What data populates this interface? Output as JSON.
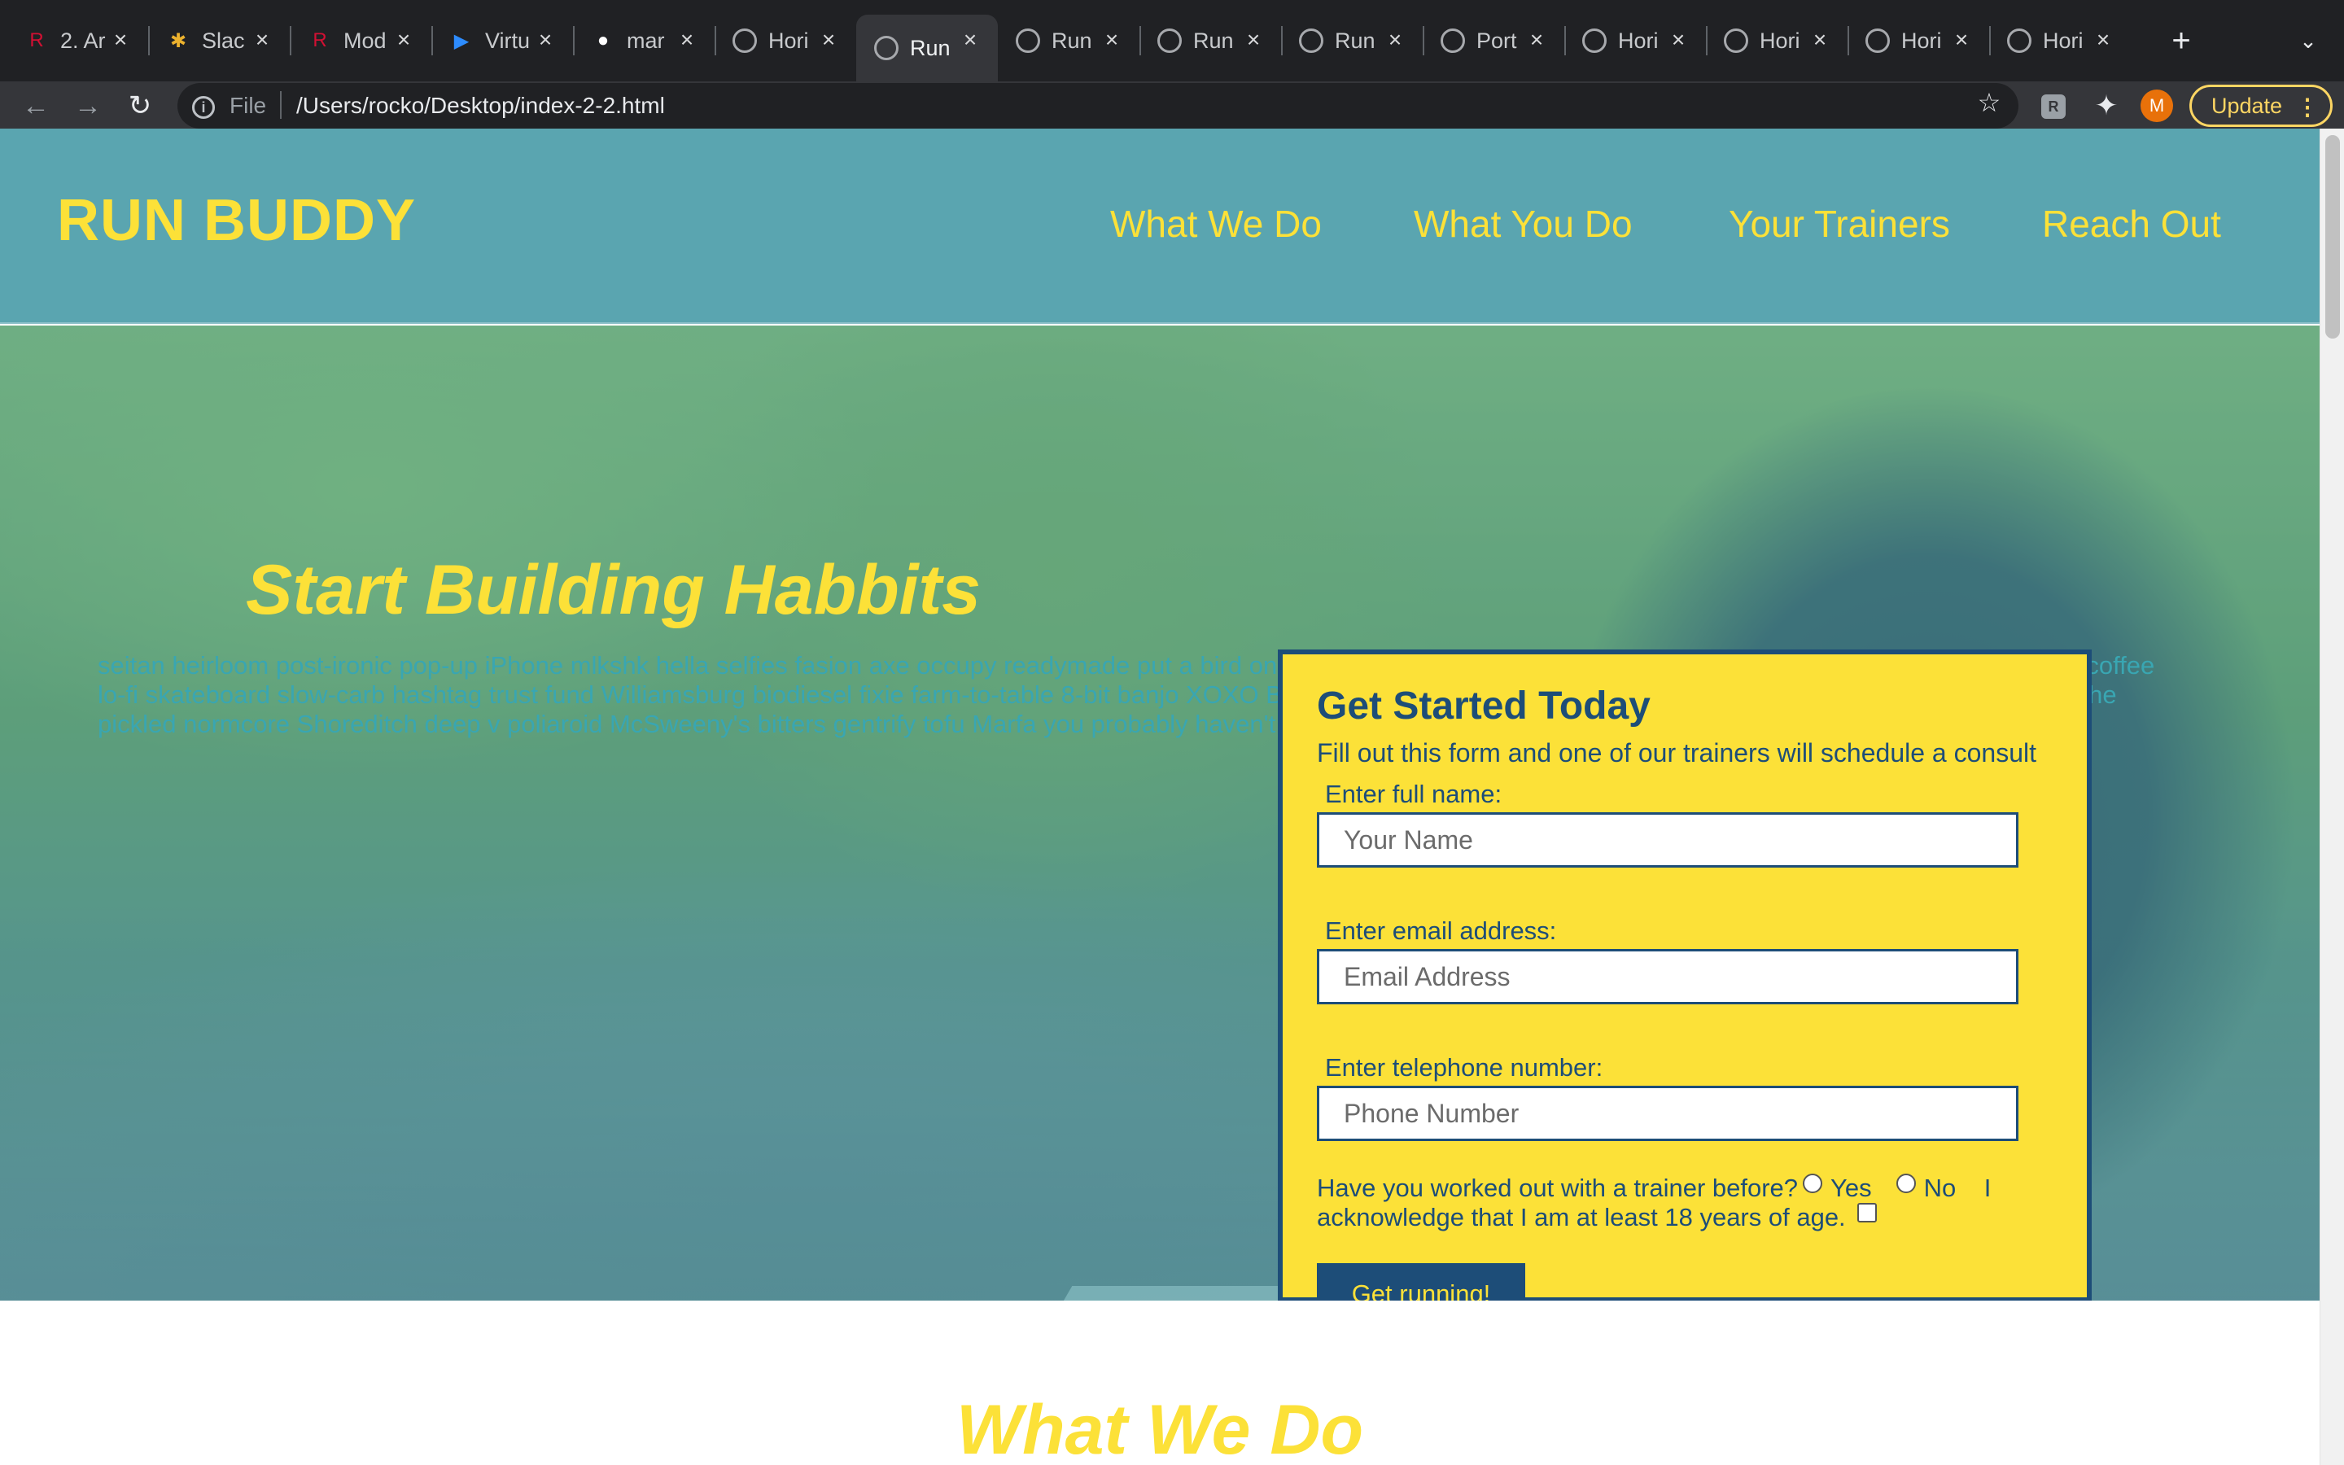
{
  "browser": {
    "tabs": [
      {
        "title": "2. Ar",
        "favicon": "rutgers-icon"
      },
      {
        "title": "Slac",
        "favicon": "slack-icon"
      },
      {
        "title": "Mod",
        "favicon": "rutgers-icon"
      },
      {
        "title": "Virtu",
        "favicon": "zoom-icon"
      },
      {
        "title": "mar",
        "favicon": "github-icon"
      },
      {
        "title": "Hori",
        "favicon": "globe-icon"
      },
      {
        "title": "Run",
        "favicon": "globe-icon",
        "active": true
      },
      {
        "title": "Run",
        "favicon": "globe-icon"
      },
      {
        "title": "Run",
        "favicon": "globe-icon"
      },
      {
        "title": "Run",
        "favicon": "globe-icon"
      },
      {
        "title": "Port",
        "favicon": "globe-icon"
      },
      {
        "title": "Hori",
        "favicon": "globe-icon"
      },
      {
        "title": "Hori",
        "favicon": "globe-icon"
      },
      {
        "title": "Hori",
        "favicon": "globe-icon"
      },
      {
        "title": "Hori",
        "favicon": "globe-icon"
      }
    ],
    "address": {
      "scheme_label": "File",
      "url": "/Users/rocko/Desktop/index-2-2.html"
    },
    "profile_initial": "M",
    "update_label": "Update"
  },
  "site": {
    "logo": "RUN BUDDY",
    "nav": [
      "What We Do",
      "What You Do",
      "Your Trainers",
      "Reach Out"
    ]
  },
  "hero": {
    "title": "Start Building Habbits",
    "copy": "seitan heirloom post-ironic pop-up iPhone mlkshk hella selfies fasion axe occupy readymade put a bird on it pour-over letterpress wolf chillwave Brooklyn direct trade single-origin coffee lo-fi skateboard slow-carb hashtag trust fund Williamsburg biodiesel fixie farm-to-table 8-bit banjo XOXO Brooklyn Austin keffiyeh raw denim chia master cleanse Tumblr fingerstache pickled normcore Shoreditch deep v poliaroid McSweeny's bitters gentrify tofu Marfa you probably haven't heard of them"
  },
  "form": {
    "title": "Get Started Today",
    "subtitle": "Fill out this form and one of our trainers will schedule a consult",
    "name_label": "Enter full name:",
    "name_placeholder": "Your Name",
    "email_label": "Enter email address:",
    "email_placeholder": "Email Address",
    "phone_label": "Enter telephone number:",
    "phone_placeholder": "Phone Number",
    "question": "Have you worked out with a trainer before?",
    "yes_label": "Yes",
    "no_label": "No",
    "ack_label": "I acknowledge that I am at least 18 years of age.",
    "submit_label": "Get running!"
  },
  "sections": {
    "what_we_do": "What We Do"
  },
  "colors": {
    "header_bg": "#5aa5b0",
    "accent_yellow": "#fce138",
    "navy": "#1d4d78",
    "teal_text": "#39a6b2"
  }
}
